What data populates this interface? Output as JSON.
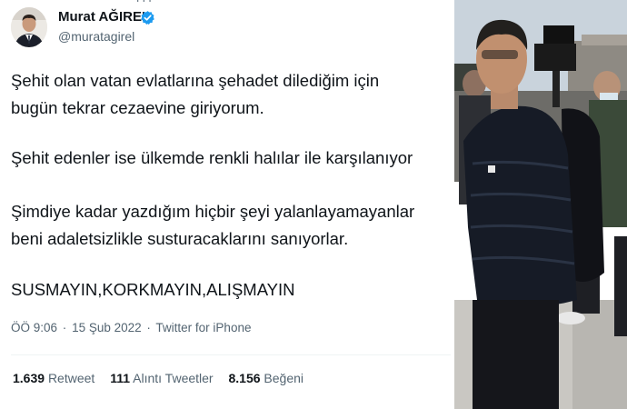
{
  "tweet": {
    "author": {
      "name": "Murat AĞIREL",
      "handle": "@muratagirel",
      "verified": true
    },
    "lines": [
      "Şehit olan vatan evlatlarına şehadet dilediğim için",
      "bugün tekrar cezaevine giriyorum.",
      "Şehit edenler ise ülkemde renkli halılar ile karşılanıyor",
      "Şimdiye kadar yazdığım hiçbir şeyi yalanlayamayanlar",
      "beni adaletsizlikle susturacaklarını sanıyorlar.",
      "SUSMAYIN,KORKMAYIN,ALIŞMAYIN"
    ],
    "time": "ÖÖ 9:06",
    "date": "15 Şub 2022",
    "source": "Twitter for iPhone",
    "stats": {
      "retweets": {
        "count": "1.639",
        "label": "Retweet"
      },
      "quotes": {
        "count": "111",
        "label": "Alıntı Tweetler"
      },
      "likes": {
        "count": "8.156",
        "label": "Beğeni"
      }
    }
  },
  "colors": {
    "text_primary": "#0f1419",
    "text_secondary": "#536471",
    "verified_badge": "#1d9bf0",
    "divider": "#eff3f4",
    "jacket": "#161b26"
  },
  "icons": {
    "verified": "verified-badge-icon"
  }
}
